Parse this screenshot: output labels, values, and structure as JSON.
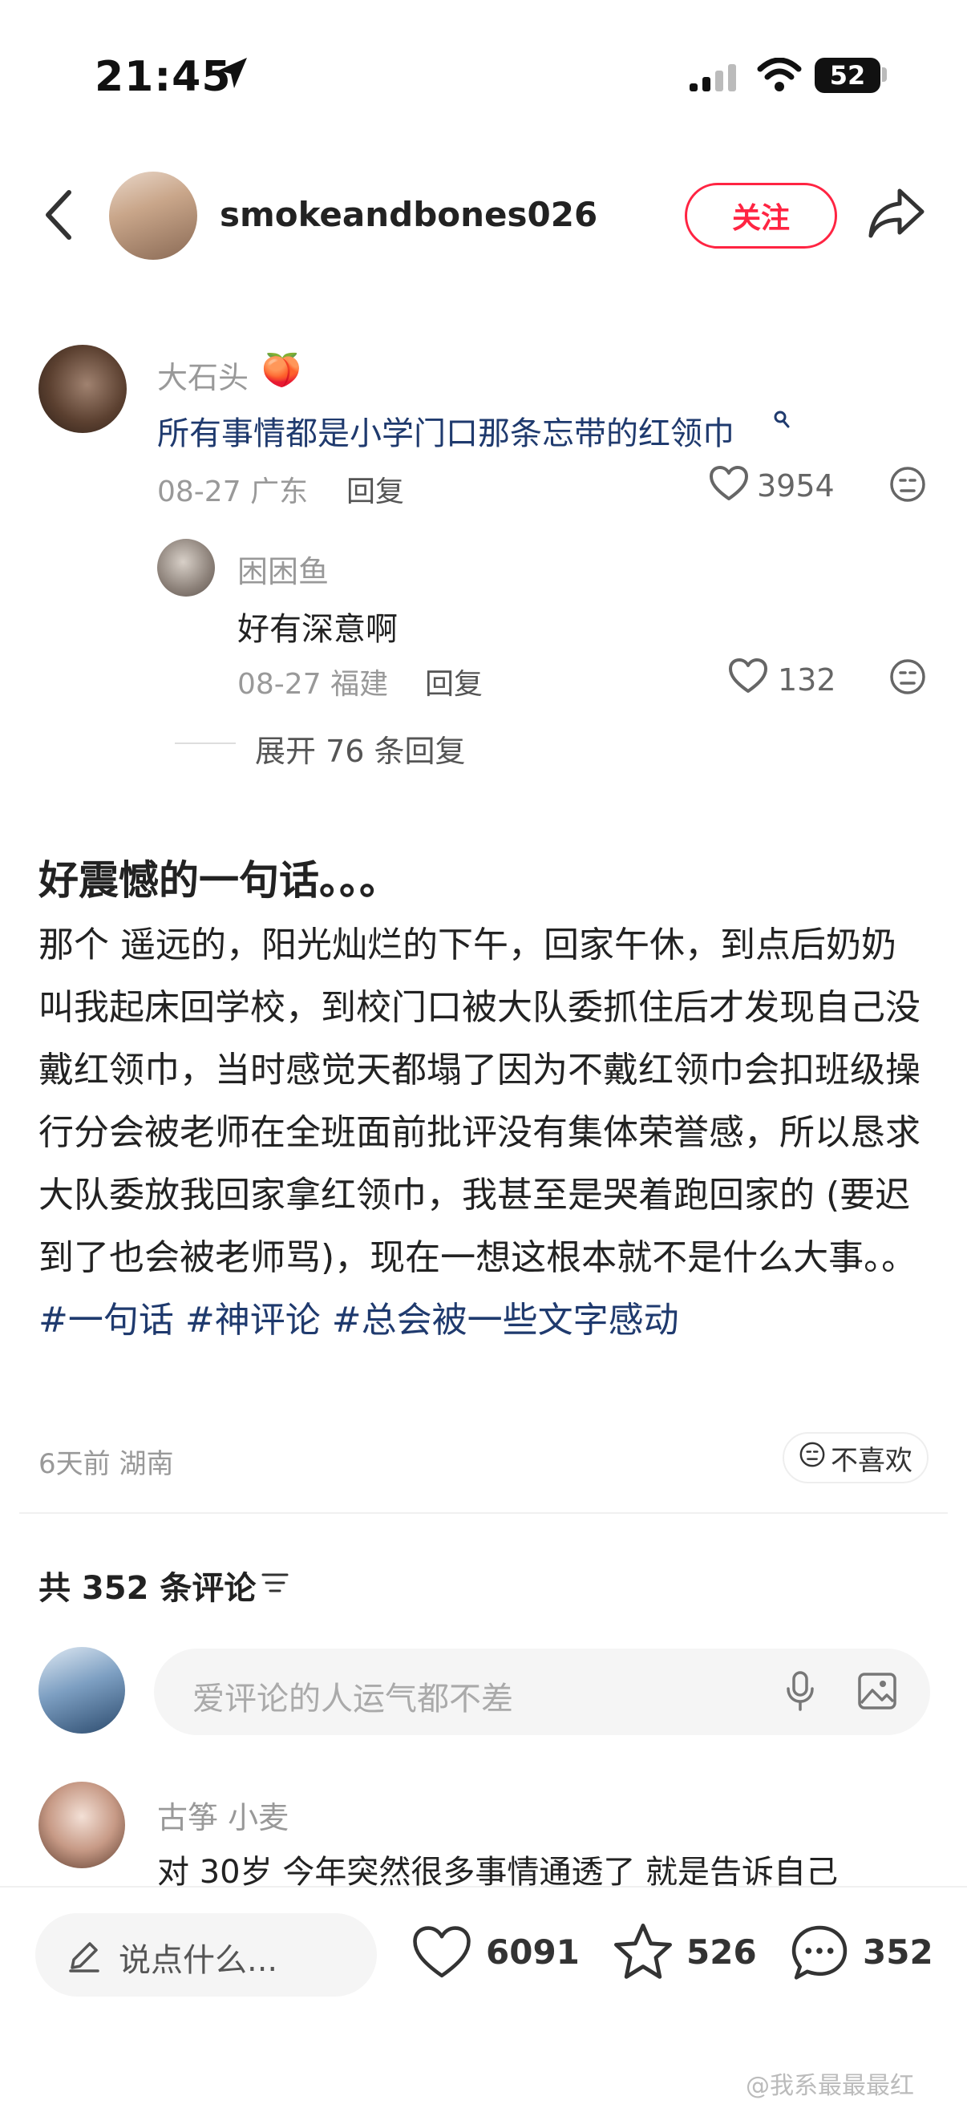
{
  "status_bar": {
    "time": "21:45",
    "battery": "52"
  },
  "header": {
    "username": "smokeandbones026",
    "follow_label": "关注"
  },
  "quoted_comments": {
    "first": {
      "name": "大石头",
      "emoji": "🍑",
      "text": "所有事情都是小学门口那条忘带的红领巾",
      "date": "08-27",
      "location": "广东",
      "reply_label": "回复",
      "likes": "3954"
    },
    "second": {
      "name": "困困鱼",
      "text": "好有深意啊",
      "date": "08-27",
      "location": "福建",
      "reply_label": "回复",
      "likes": "132"
    },
    "expand_label": "展开 76 条回复"
  },
  "post": {
    "title": "好震憾的一句话。。。",
    "body": "那个 遥远的，阳光灿烂的下午，回家午休，到点后奶奶叫我起床回学校，到校门口被大队委抓住后才发现自己没戴红领巾，当时感觉天都塌了因为不戴红领巾会扣班级操行分会被老师在全班面前批评没有集体荣誉感，所以恳求大队委放我回家拿红领巾，我甚至是哭着跑回家的 (要迟到了也会被老师骂)，现在一想这根本就不是什么大事。。",
    "tags": "#一句话 #神评论 #总会被一些文字感动",
    "time": "6天前",
    "location": "湖南",
    "dislike_label": "不喜欢"
  },
  "comments": {
    "count_label": "共 352 条评论",
    "input_placeholder": "爱评论的人运气都不差",
    "first": {
      "name": "古筝 小麦",
      "text": "对  30岁  今年突然很多事情通透了  就是告诉自己"
    }
  },
  "bottom_bar": {
    "say_placeholder": "说点什么...",
    "likes": "6091",
    "stars": "526",
    "comments": "352"
  },
  "watermark": "@我系最最最红",
  "colors": {
    "accent": "#ff2442",
    "link": "#1f3a6e"
  }
}
